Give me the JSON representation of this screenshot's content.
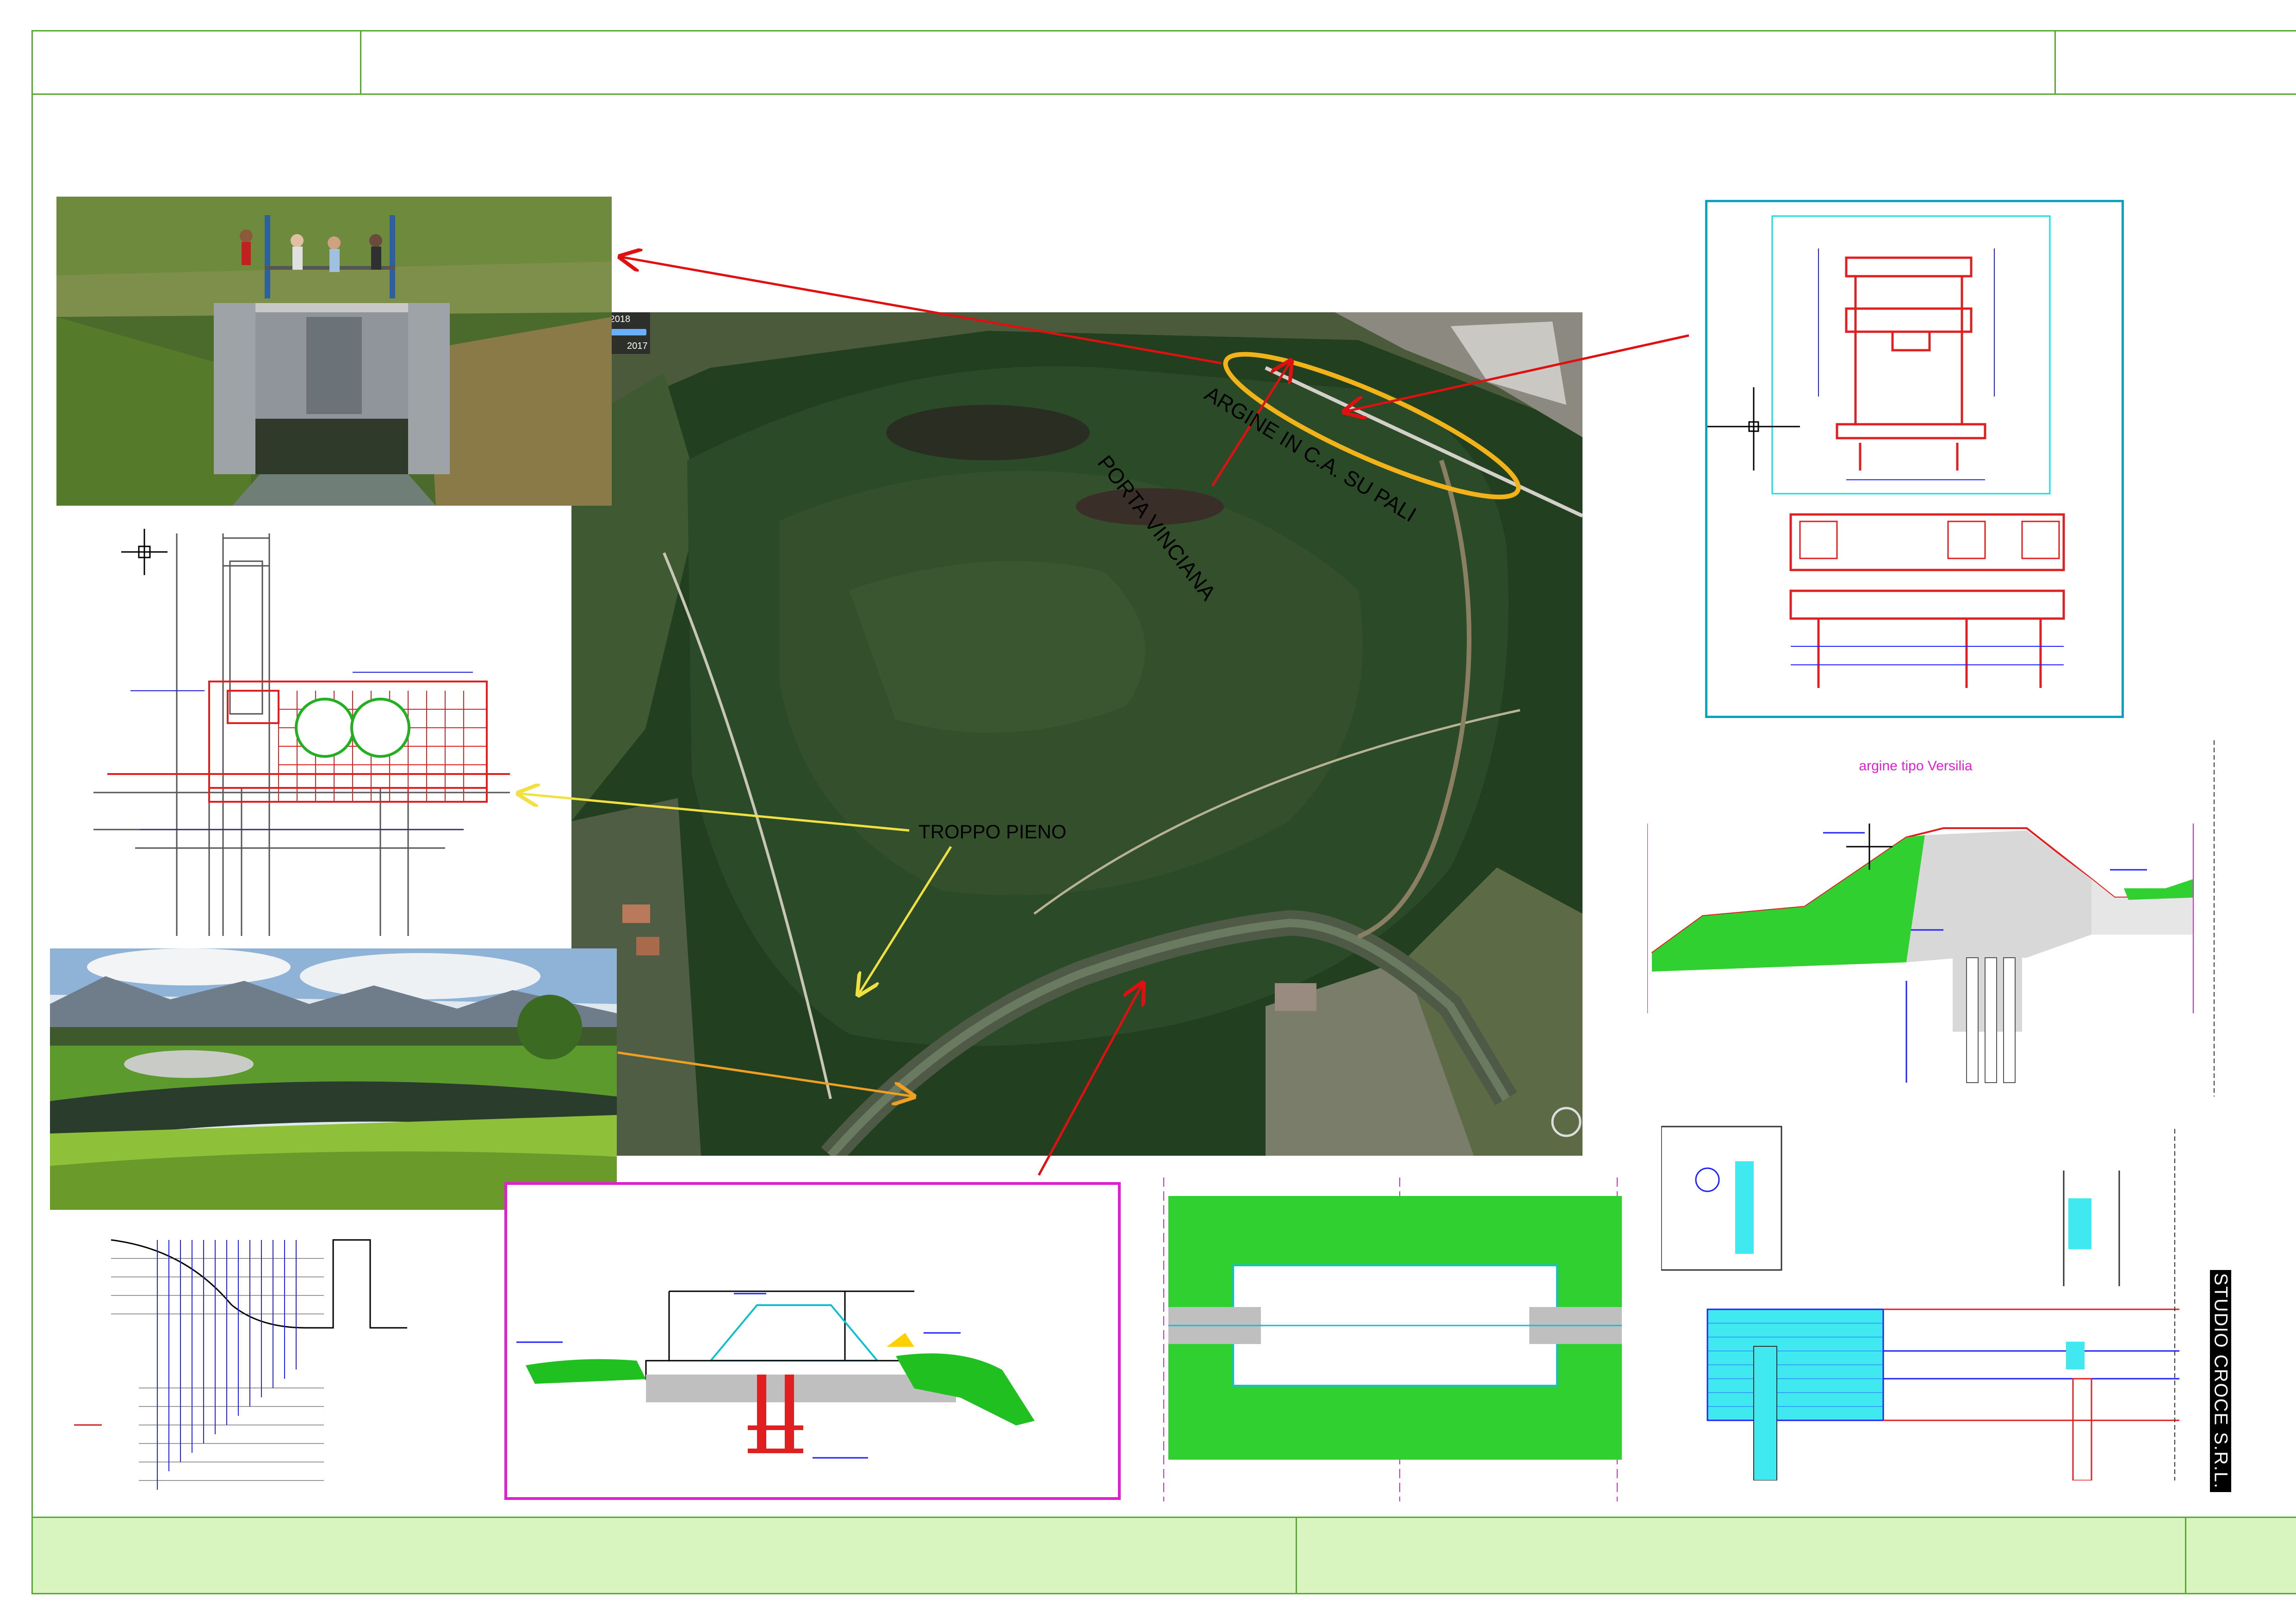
{
  "sheet": {
    "studio": "STUDIO CROCE S.R.L.",
    "accent_green": "#5aa832",
    "footer_fill": "#d8f5c0"
  },
  "aerial": {
    "date_start": "2/2018",
    "date_end": "2017",
    "labels": {
      "argine": "ARGINE IN C.A. SU PALI",
      "porta": "PORTA VINCIANA",
      "troppo": "TROPPO PIENO"
    },
    "colors": {
      "arrow_red": "#e01010",
      "arrow_yellow": "#f0e040",
      "arrow_orange": "#f0a020",
      "ellipse": "#f2b21a"
    }
  },
  "drawings": {
    "argine_versilia_title": "argine tipo Versilia"
  }
}
